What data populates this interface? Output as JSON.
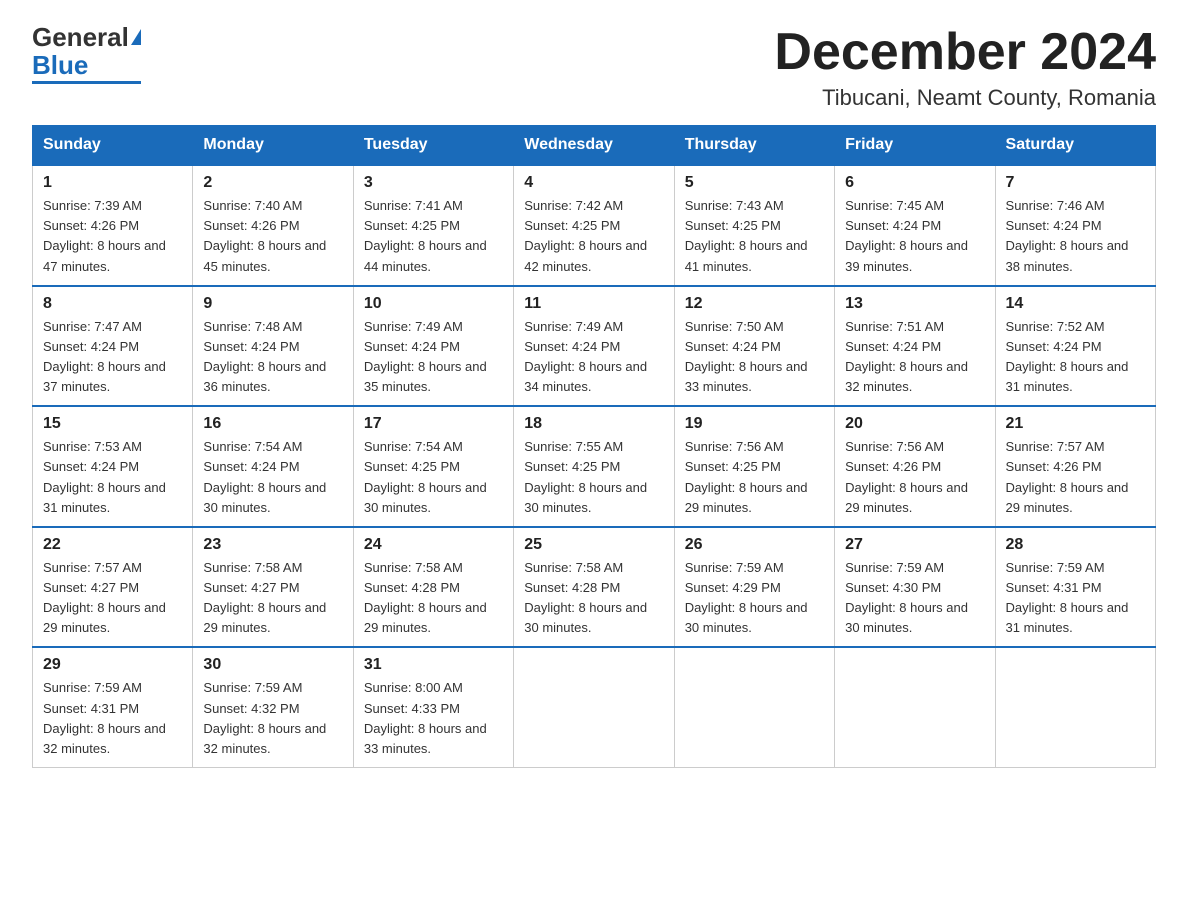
{
  "logo": {
    "general": "General",
    "blue": "Blue"
  },
  "title": "December 2024",
  "subtitle": "Tibucani, Neamt County, Romania",
  "days_of_week": [
    "Sunday",
    "Monday",
    "Tuesday",
    "Wednesday",
    "Thursday",
    "Friday",
    "Saturday"
  ],
  "weeks": [
    [
      {
        "day": "1",
        "sunrise": "7:39 AM",
        "sunset": "4:26 PM",
        "daylight": "8 hours and 47 minutes."
      },
      {
        "day": "2",
        "sunrise": "7:40 AM",
        "sunset": "4:26 PM",
        "daylight": "8 hours and 45 minutes."
      },
      {
        "day": "3",
        "sunrise": "7:41 AM",
        "sunset": "4:25 PM",
        "daylight": "8 hours and 44 minutes."
      },
      {
        "day": "4",
        "sunrise": "7:42 AM",
        "sunset": "4:25 PM",
        "daylight": "8 hours and 42 minutes."
      },
      {
        "day": "5",
        "sunrise": "7:43 AM",
        "sunset": "4:25 PM",
        "daylight": "8 hours and 41 minutes."
      },
      {
        "day": "6",
        "sunrise": "7:45 AM",
        "sunset": "4:24 PM",
        "daylight": "8 hours and 39 minutes."
      },
      {
        "day": "7",
        "sunrise": "7:46 AM",
        "sunset": "4:24 PM",
        "daylight": "8 hours and 38 minutes."
      }
    ],
    [
      {
        "day": "8",
        "sunrise": "7:47 AM",
        "sunset": "4:24 PM",
        "daylight": "8 hours and 37 minutes."
      },
      {
        "day": "9",
        "sunrise": "7:48 AM",
        "sunset": "4:24 PM",
        "daylight": "8 hours and 36 minutes."
      },
      {
        "day": "10",
        "sunrise": "7:49 AM",
        "sunset": "4:24 PM",
        "daylight": "8 hours and 35 minutes."
      },
      {
        "day": "11",
        "sunrise": "7:49 AM",
        "sunset": "4:24 PM",
        "daylight": "8 hours and 34 minutes."
      },
      {
        "day": "12",
        "sunrise": "7:50 AM",
        "sunset": "4:24 PM",
        "daylight": "8 hours and 33 minutes."
      },
      {
        "day": "13",
        "sunrise": "7:51 AM",
        "sunset": "4:24 PM",
        "daylight": "8 hours and 32 minutes."
      },
      {
        "day": "14",
        "sunrise": "7:52 AM",
        "sunset": "4:24 PM",
        "daylight": "8 hours and 31 minutes."
      }
    ],
    [
      {
        "day": "15",
        "sunrise": "7:53 AM",
        "sunset": "4:24 PM",
        "daylight": "8 hours and 31 minutes."
      },
      {
        "day": "16",
        "sunrise": "7:54 AM",
        "sunset": "4:24 PM",
        "daylight": "8 hours and 30 minutes."
      },
      {
        "day": "17",
        "sunrise": "7:54 AM",
        "sunset": "4:25 PM",
        "daylight": "8 hours and 30 minutes."
      },
      {
        "day": "18",
        "sunrise": "7:55 AM",
        "sunset": "4:25 PM",
        "daylight": "8 hours and 30 minutes."
      },
      {
        "day": "19",
        "sunrise": "7:56 AM",
        "sunset": "4:25 PM",
        "daylight": "8 hours and 29 minutes."
      },
      {
        "day": "20",
        "sunrise": "7:56 AM",
        "sunset": "4:26 PM",
        "daylight": "8 hours and 29 minutes."
      },
      {
        "day": "21",
        "sunrise": "7:57 AM",
        "sunset": "4:26 PM",
        "daylight": "8 hours and 29 minutes."
      }
    ],
    [
      {
        "day": "22",
        "sunrise": "7:57 AM",
        "sunset": "4:27 PM",
        "daylight": "8 hours and 29 minutes."
      },
      {
        "day": "23",
        "sunrise": "7:58 AM",
        "sunset": "4:27 PM",
        "daylight": "8 hours and 29 minutes."
      },
      {
        "day": "24",
        "sunrise": "7:58 AM",
        "sunset": "4:28 PM",
        "daylight": "8 hours and 29 minutes."
      },
      {
        "day": "25",
        "sunrise": "7:58 AM",
        "sunset": "4:28 PM",
        "daylight": "8 hours and 30 minutes."
      },
      {
        "day": "26",
        "sunrise": "7:59 AM",
        "sunset": "4:29 PM",
        "daylight": "8 hours and 30 minutes."
      },
      {
        "day": "27",
        "sunrise": "7:59 AM",
        "sunset": "4:30 PM",
        "daylight": "8 hours and 30 minutes."
      },
      {
        "day": "28",
        "sunrise": "7:59 AM",
        "sunset": "4:31 PM",
        "daylight": "8 hours and 31 minutes."
      }
    ],
    [
      {
        "day": "29",
        "sunrise": "7:59 AM",
        "sunset": "4:31 PM",
        "daylight": "8 hours and 32 minutes."
      },
      {
        "day": "30",
        "sunrise": "7:59 AM",
        "sunset": "4:32 PM",
        "daylight": "8 hours and 32 minutes."
      },
      {
        "day": "31",
        "sunrise": "8:00 AM",
        "sunset": "4:33 PM",
        "daylight": "8 hours and 33 minutes."
      },
      null,
      null,
      null,
      null
    ]
  ]
}
